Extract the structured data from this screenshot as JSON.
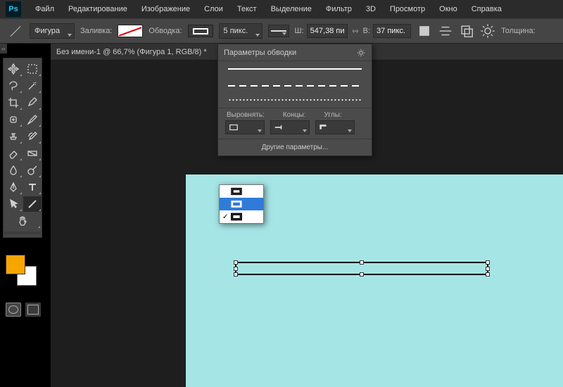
{
  "app": {
    "logo": "Ps"
  },
  "menu": [
    "Файл",
    "Редактирование",
    "Изображение",
    "Слои",
    "Текст",
    "Выделение",
    "Фильтр",
    "3D",
    "Просмотр",
    "Окно",
    "Справка"
  ],
  "options": {
    "mode_label": "Фигура",
    "fill_label": "Заливка:",
    "stroke_label": "Обводка:",
    "stroke_width": "5 пикс.",
    "width_label": "Ш:",
    "width_value": "547,38 пи",
    "height_label": "В:",
    "height_value": "37 пикс.",
    "weight_label": "Толщина:",
    "link_icon": "link"
  },
  "tab": {
    "title": "Без имени-1 @ 66,7% (Фигура 1, RGB/8) *"
  },
  "popover": {
    "title": "Параметры обводки",
    "align_label": "Выровнять:",
    "caps_label": "Концы:",
    "corners_label": "Углы:",
    "more": "Другие параметры..."
  },
  "align_options": [
    "inside",
    "center",
    "outside"
  ],
  "colors": {
    "canvas": "#a6e5e6",
    "foreground": "#f7a500",
    "background": "#ffffff",
    "accent": "#2f7bd9"
  }
}
